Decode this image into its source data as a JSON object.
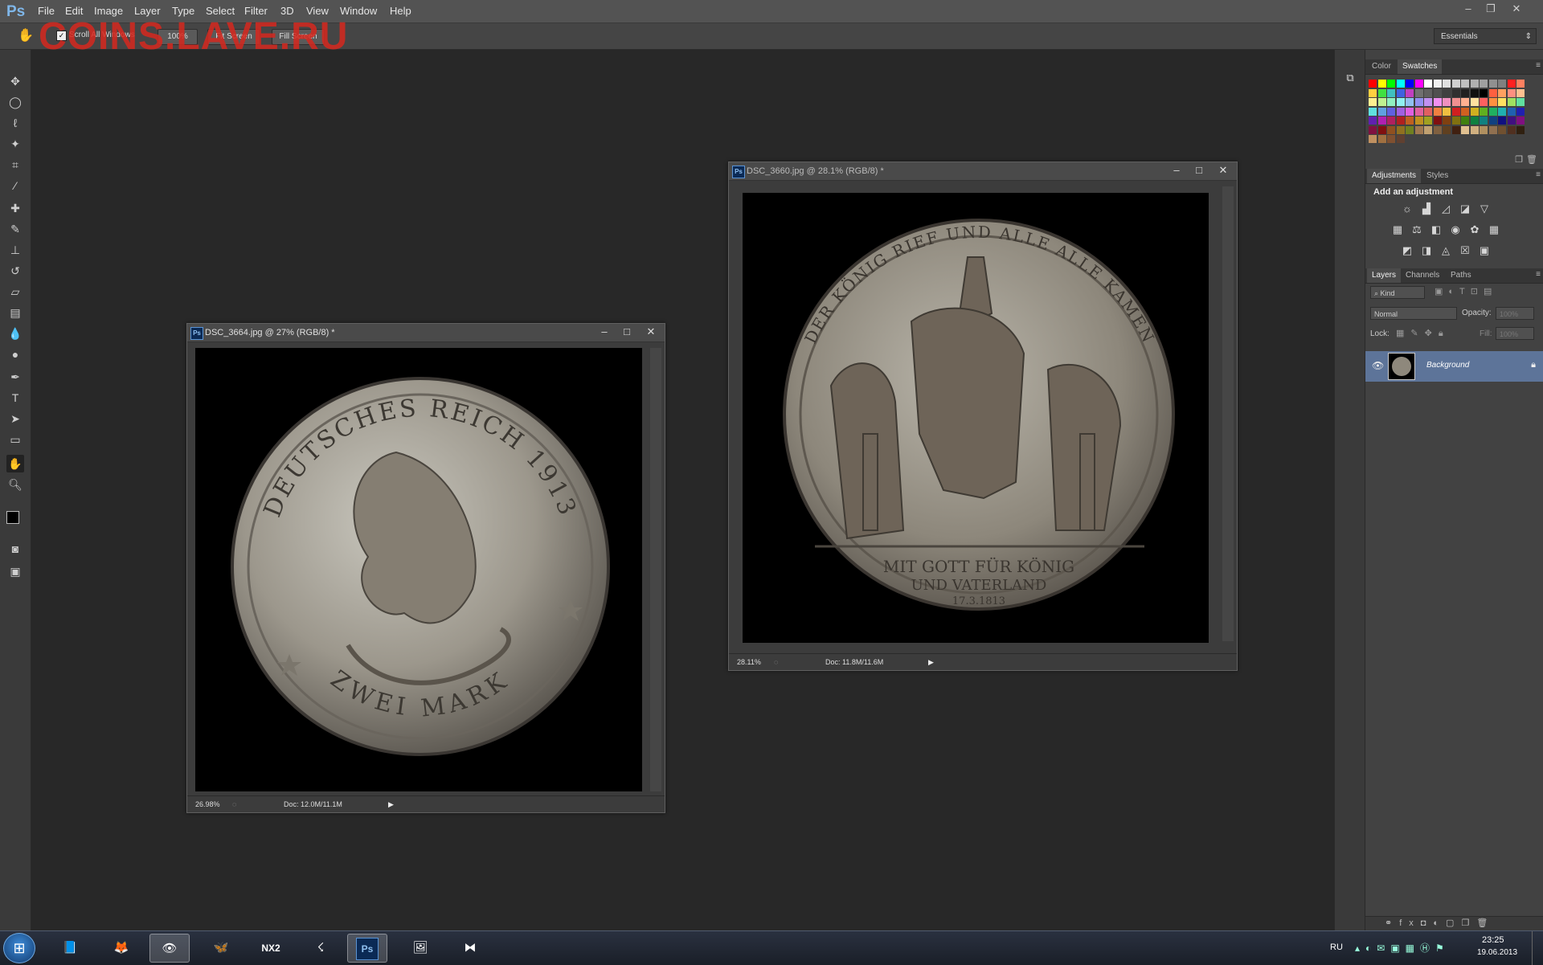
{
  "app": {
    "logo": "Ps",
    "watermark": "COINS.LAVE.RU"
  },
  "menu": [
    "File",
    "Edit",
    "Image",
    "Layer",
    "Type",
    "Select",
    "Filter",
    "3D",
    "View",
    "Window",
    "Help"
  ],
  "options_bar": {
    "scroll_all_windows": "Scroll All Windows",
    "btn_100": "100%",
    "btn_fit_screen": "Fit Screen",
    "btn_fill_screen": "Fill Screen",
    "workspace": "Essentials"
  },
  "doc1": {
    "title": "DSC_3664.jpg @ 27% (RGB/8) *",
    "zoom": "26.98%",
    "doc_size": "Doc: 12.0M/11.1M",
    "coin": {
      "top_text": "DEUTSCHES REICH 1913",
      "bottom_text": "ZWEI MARK"
    }
  },
  "doc2": {
    "title": "DSC_3660.jpg @ 28.1% (RGB/8) *",
    "zoom": "28.11%",
    "doc_size": "Doc: 11.8M/11.6M",
    "coin": {
      "top_text": "DER KÖNIG RIEF UND ALLE ALLE KAMEN",
      "motto_1": "MIT GOTT FÜR KÖNIG",
      "motto_2": "UND VATERLAND",
      "dates": "17.3.1813"
    }
  },
  "panels": {
    "color_tab": "Color",
    "swatches_tab": "Swatches",
    "adjustments_tab": "Adjustments",
    "styles_tab": "Styles",
    "add_adjustment": "Add an adjustment",
    "layers_tab": "Layers",
    "channels_tab": "Channels",
    "paths_tab": "Paths",
    "kind": "Kind",
    "blend_mode": "Normal",
    "opacity_label": "Opacity:",
    "opacity_value": "100%",
    "lock_label": "Lock:",
    "fill_label": "Fill:",
    "fill_value": "100%",
    "layer_name": "Background"
  },
  "swatch_colors": [
    "#ff0000",
    "#ffff00",
    "#00ff00",
    "#00ffff",
    "#0000ff",
    "#ff00ff",
    "#ffffff",
    "#f0f0f0",
    "#e0e0e0",
    "#d0d0d0",
    "#c0c0c0",
    "#b0b0b0",
    "#a0a0a0",
    "#909090",
    "#808080",
    "#ff2020",
    "#ff8060",
    "#ffd040",
    "#40e040",
    "#40c0c0",
    "#4060e0",
    "#c040c0",
    "#707070",
    "#606060",
    "#505050",
    "#404040",
    "#303030",
    "#202020",
    "#101010",
    "#000000",
    "#ff6040",
    "#ffa060",
    "#ff9080",
    "#ffc090",
    "#fff090",
    "#c0f090",
    "#90f0c0",
    "#90f0f0",
    "#90c0f0",
    "#9090f0",
    "#c090f0",
    "#f090f0",
    "#f090c0",
    "#f09090",
    "#ffb090",
    "#ffe0a0",
    "#ff6060",
    "#ff9040",
    "#ffe060",
    "#a0e060",
    "#60e0a0",
    "#60e0e0",
    "#60a0e0",
    "#6060e0",
    "#a060e0",
    "#e060e0",
    "#e060a0",
    "#e06060",
    "#f08040",
    "#f0c040",
    "#d02020",
    "#d06020",
    "#d0b020",
    "#60b020",
    "#20b060",
    "#20b0b0",
    "#2060b0",
    "#2020b0",
    "#6020b0",
    "#b020b0",
    "#b02060",
    "#b02020",
    "#c06020",
    "#c09020",
    "#a0a020",
    "#801010",
    "#804010",
    "#807010",
    "#408010",
    "#108040",
    "#108080",
    "#104080",
    "#101080",
    "#401080",
    "#801080",
    "#801040",
    "#801010",
    "#905020",
    "#907020",
    "#708020",
    "#a07850",
    "#c0a070",
    "#806040",
    "#604020",
    "#402010",
    "#e0c090",
    "#d0b080",
    "#b09060",
    "#907050",
    "#705030",
    "#503020",
    "#302010",
    "#c09060",
    "#a07040",
    "#805030",
    "#604030"
  ],
  "taskbar": {
    "lang": "RU",
    "time": "23:25",
    "date": "19.06.2013"
  }
}
